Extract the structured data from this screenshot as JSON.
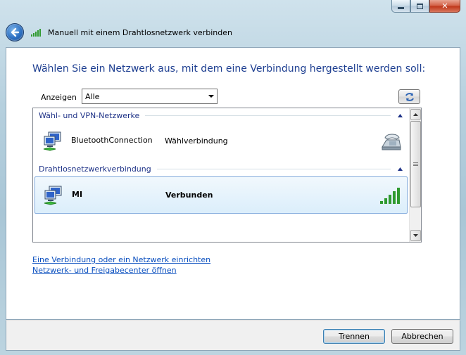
{
  "window": {
    "title": "Manuell mit einem Drahtlosnetzwerk verbinden",
    "controls": [
      "minimize-button",
      "maximize-button",
      "close-button"
    ]
  },
  "main": {
    "heading": "Wählen Sie ein Netzwerk aus, mit dem eine Verbindung hergestellt werden soll:",
    "filter": {
      "label": "Anzeigen",
      "selected": "Alle"
    },
    "groups": [
      {
        "title": "Wähl- und VPN-Netzwerke",
        "networks": [
          {
            "name": "BluetoothConnection",
            "status": "Wählverbindung",
            "icon": "phone-modem-icon",
            "selected": false
          }
        ]
      },
      {
        "title": "Drahtlosnetzwerkverbindung",
        "networks": [
          {
            "name": "MI",
            "status": "Verbunden",
            "icon": "signal-strength-icon",
            "signal_bars": 5,
            "selected": true
          }
        ]
      }
    ],
    "links": {
      "setup": "Eine Verbindung oder ein Netzwerk einrichten",
      "network_center": "Netzwerk- und Freigabecenter öffnen"
    }
  },
  "footer": {
    "disconnect_label": "Trennen",
    "cancel_label": "Abbrechen"
  },
  "colors": {
    "heading": "#1e3f91",
    "link": "#0a4fbf",
    "group_header": "#1e3287",
    "selection": "#dbeefb",
    "signal": "#2f9a2f"
  }
}
